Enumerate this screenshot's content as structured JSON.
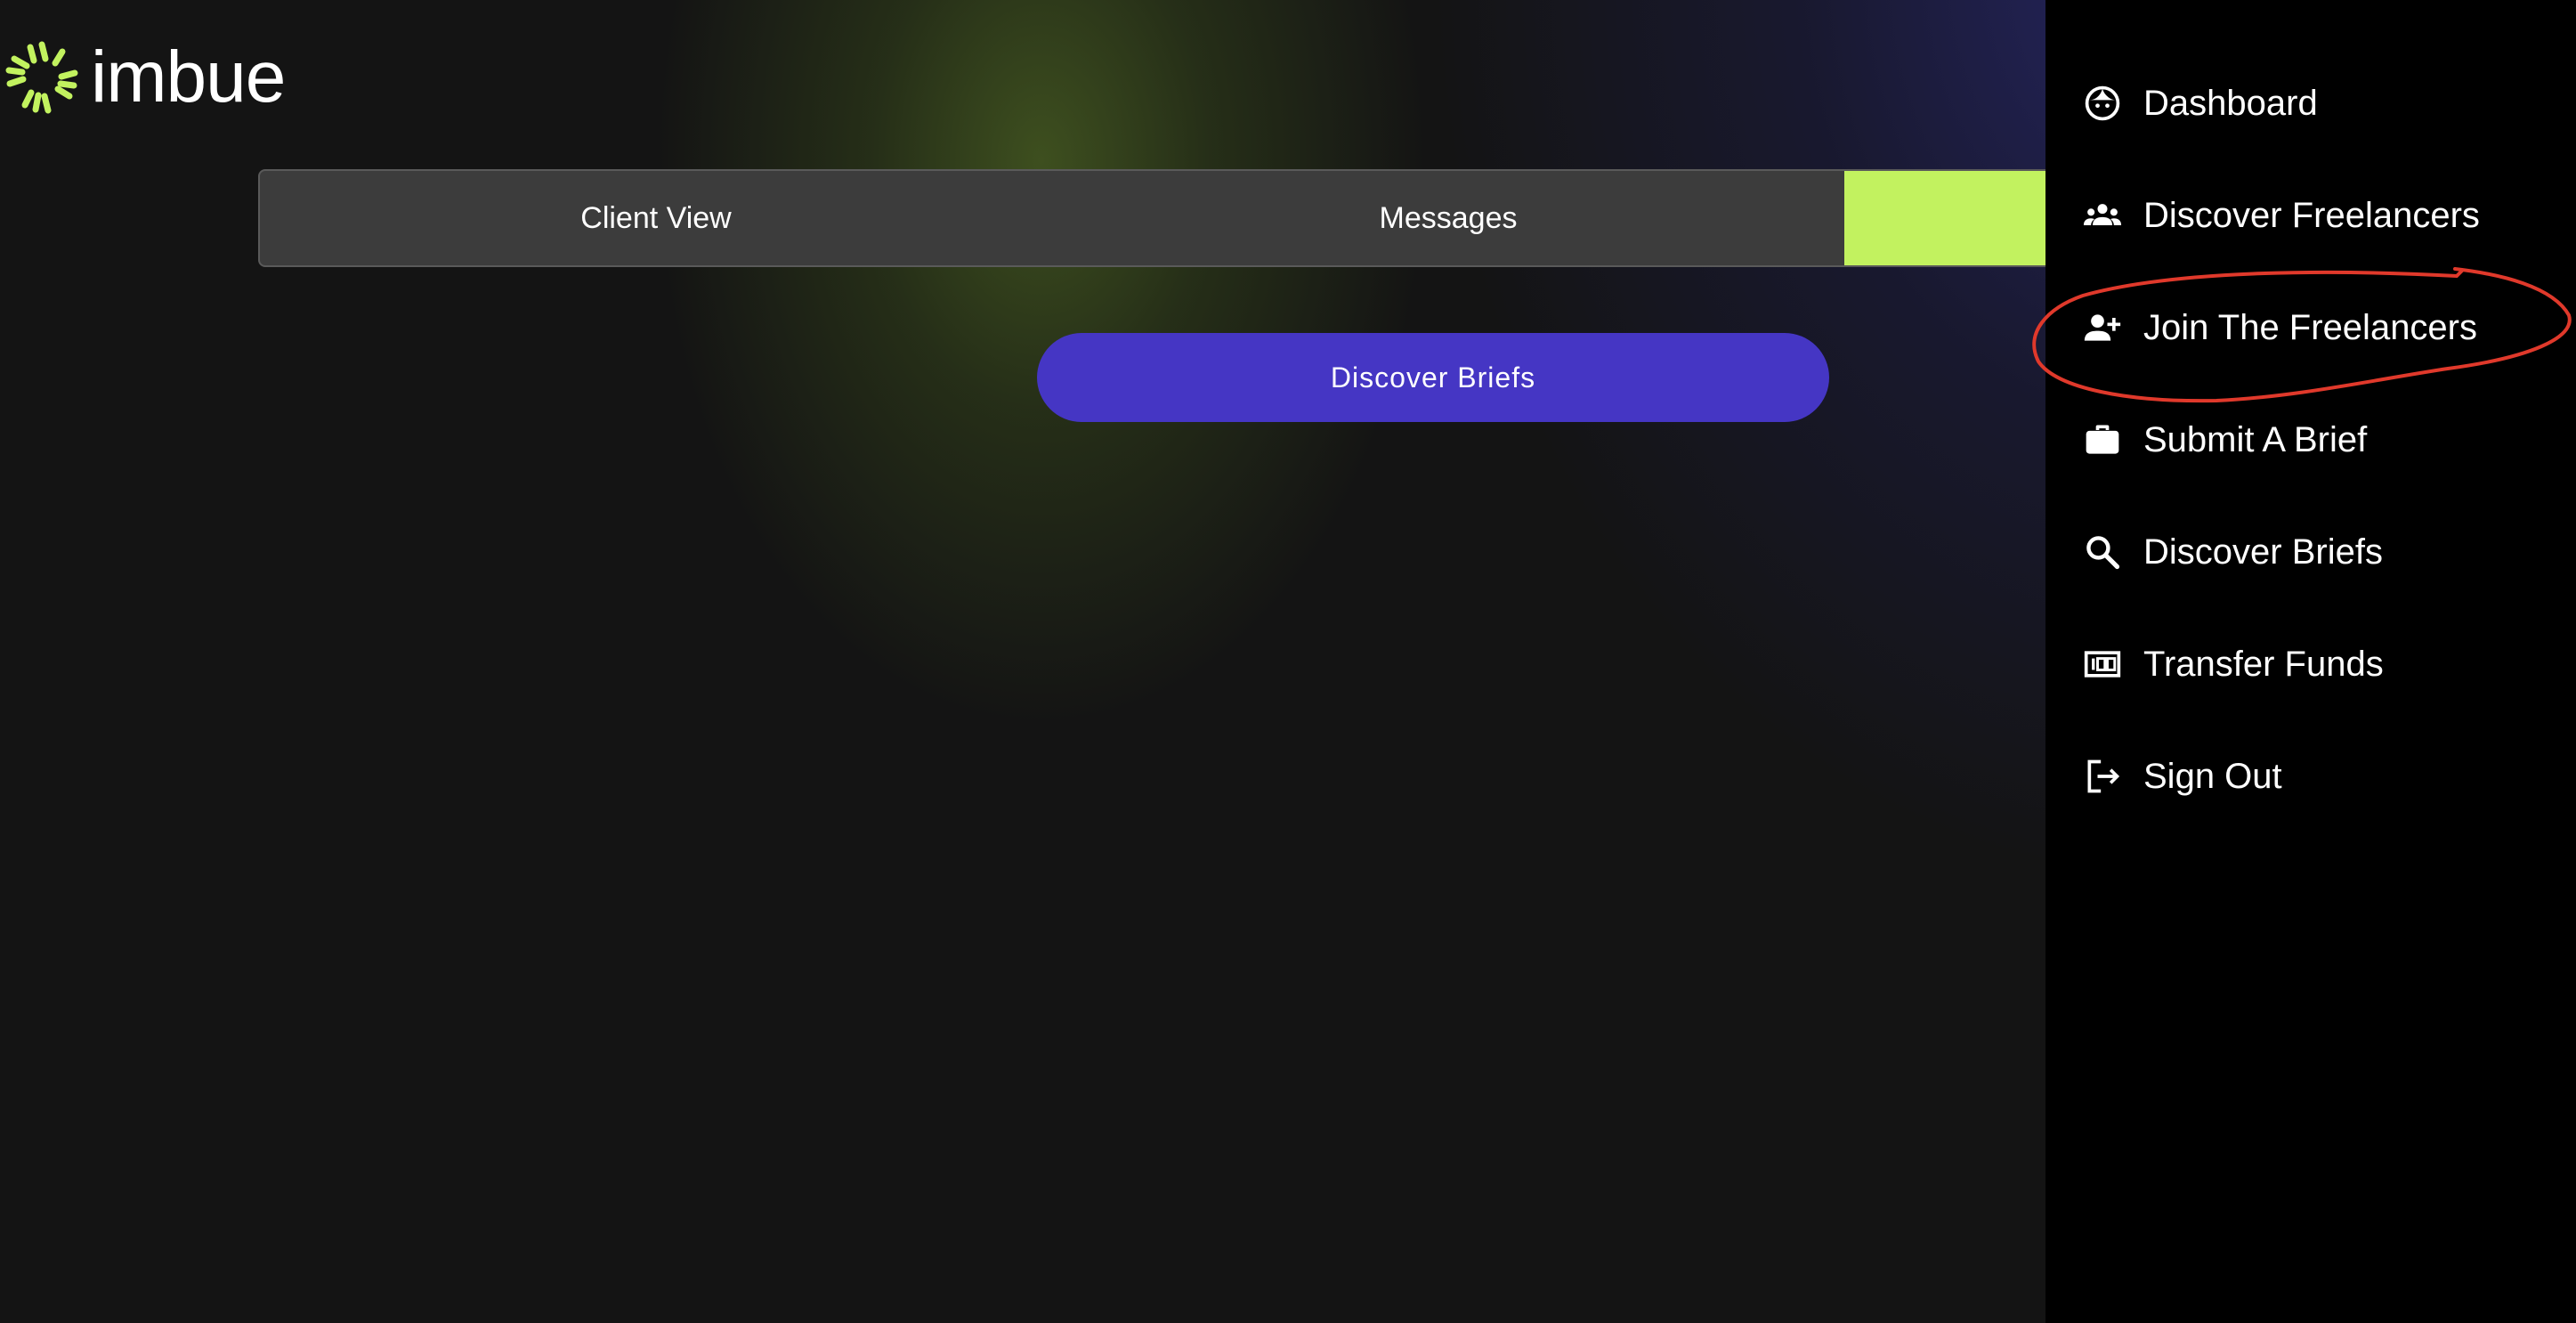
{
  "brand": {
    "name": "imbue",
    "accent_color": "#c2f25f"
  },
  "tabs": [
    {
      "label": "Client View"
    },
    {
      "label": "Messages"
    },
    {
      "label": ""
    }
  ],
  "main": {
    "discover_button_label": "Discover Briefs",
    "button_color": "#4536c4"
  },
  "drawer": {
    "items": [
      {
        "label": "Dashboard",
        "icon": "face-icon"
      },
      {
        "label": "Discover Freelancers",
        "icon": "people-icon"
      },
      {
        "label": "Join The Freelancers",
        "icon": "person-add-icon"
      },
      {
        "label": "Submit A Brief",
        "icon": "briefcase-icon"
      },
      {
        "label": "Discover Briefs",
        "icon": "search-icon"
      },
      {
        "label": "Transfer Funds",
        "icon": "money-icon"
      },
      {
        "label": "Sign Out",
        "icon": "logout-icon"
      }
    ]
  },
  "annotation": {
    "color": "#e0392b",
    "target": "Join The Freelancers"
  }
}
